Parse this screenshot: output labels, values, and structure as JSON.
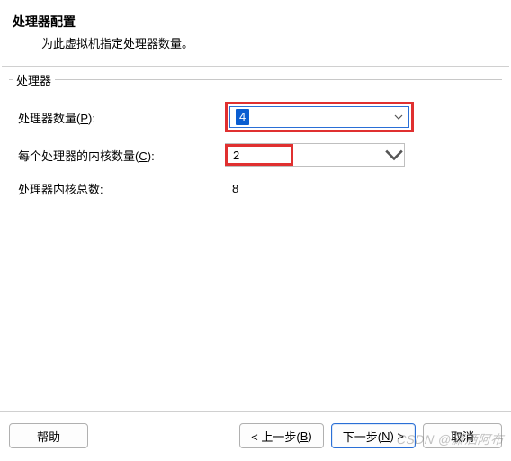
{
  "header": {
    "title": "处理器配置",
    "subtitle": "为此虚拟机指定处理器数量。"
  },
  "group": {
    "legend": "处理器",
    "rows": {
      "processors": {
        "label_before": "处理器数量(",
        "accel": "P",
        "label_after": "):",
        "value": "4"
      },
      "cores": {
        "label_before": "每个处理器的内核数量(",
        "accel": "C",
        "label_after": "):",
        "value": "2"
      },
      "total": {
        "label": "处理器内核总数:",
        "value": "8"
      }
    }
  },
  "footer": {
    "help": "帮助",
    "back_before": "< 上一步(",
    "back_accel": "B",
    "back_after": ")",
    "next_before": "下一步(",
    "next_accel": "N",
    "next_after": ") >",
    "cancel": "取消"
  },
  "watermark": "CSDN @潇洒阿布"
}
